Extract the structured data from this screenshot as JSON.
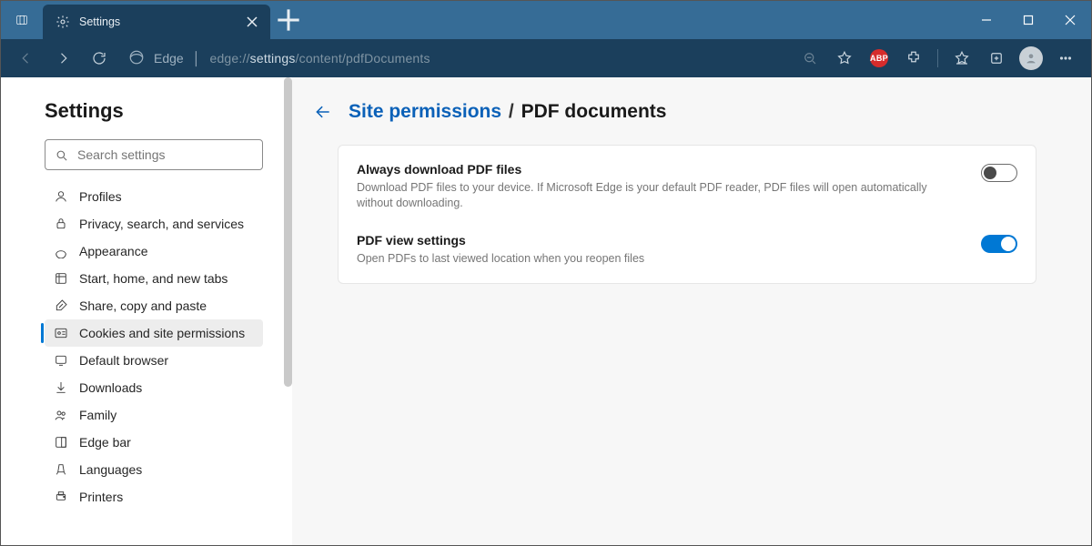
{
  "window": {
    "tab_title": "Settings"
  },
  "address": {
    "scheme_label": "Edge",
    "url_prefix": "edge://",
    "url_bold": "settings",
    "url_suffix": "/content/pdfDocuments"
  },
  "toolbar_icons": {
    "abp_label": "ABP"
  },
  "sidebar": {
    "heading": "Settings",
    "search_placeholder": "Search settings",
    "items": [
      {
        "label": "Profiles"
      },
      {
        "label": "Privacy, search, and services"
      },
      {
        "label": "Appearance"
      },
      {
        "label": "Start, home, and new tabs"
      },
      {
        "label": "Share, copy and paste"
      },
      {
        "label": "Cookies and site permissions"
      },
      {
        "label": "Default browser"
      },
      {
        "label": "Downloads"
      },
      {
        "label": "Family"
      },
      {
        "label": "Edge bar"
      },
      {
        "label": "Languages"
      },
      {
        "label": "Printers"
      }
    ],
    "active_index": 5
  },
  "breadcrumb": {
    "parent": "Site permissions",
    "separator": "/",
    "current": "PDF documents"
  },
  "settings": [
    {
      "title": "Always download PDF files",
      "desc": "Download PDF files to your device. If Microsoft Edge is your default PDF reader, PDF files will open automatically without downloading.",
      "enabled": false
    },
    {
      "title": "PDF view settings",
      "desc": "Open PDFs to last viewed location when you reopen files",
      "enabled": true
    }
  ]
}
